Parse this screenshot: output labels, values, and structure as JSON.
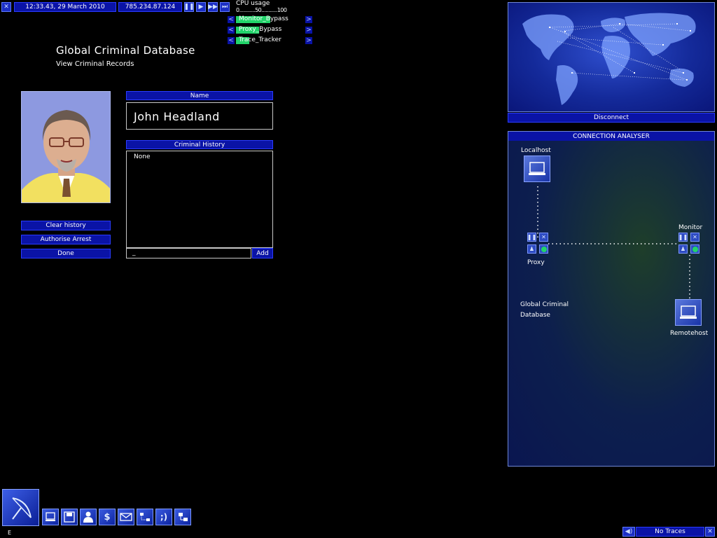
{
  "topbar": {
    "close_icon": "close-icon",
    "datetime": "12:33.43, 29 March 2010",
    "ip": "785.234.87.124",
    "speed_icons": [
      "pause-icon",
      "play-icon",
      "fast-forward-icon",
      "fastest-forward-icon"
    ]
  },
  "cpu": {
    "title": "CPU usage",
    "scale": "0...........50...........100",
    "programs": [
      {
        "name": "Monitor_Bypass",
        "usage": 0.52
      },
      {
        "name": "Proxy_Bypass",
        "usage": 0.35
      },
      {
        "name": "Trace_Tracker",
        "usage": 0.2
      }
    ]
  },
  "page": {
    "title": "Global Criminal Database",
    "subtitle": "View Criminal Records"
  },
  "record": {
    "name_header": "Name",
    "name": "John Headland",
    "history_header": "Criminal History",
    "history_text": "None",
    "new_entry_value": "_",
    "add_label": "Add",
    "buttons": [
      "Clear history",
      "Authorise Arrest",
      "Done"
    ]
  },
  "worldmap": {
    "disconnect_label": "Disconnect"
  },
  "analyser": {
    "title": "CONNECTION ANALYSER",
    "localhost": "Localhost",
    "proxy": "Proxy",
    "monitor": "Monitor",
    "remotehost": "Remotehost",
    "target_line1": "Global Criminal",
    "target_line2": "Database"
  },
  "taskbar": {
    "main_icon": "satellite-dish-icon",
    "tools": [
      "computer-icon",
      "disk-icon",
      "people-icon",
      "dollar-icon",
      "email-icon",
      "network-icon",
      "chat-icon",
      "gateway-icon"
    ],
    "status_letter": "E"
  },
  "trace": {
    "label": "No Traces",
    "sound_icon": "speaker-icon",
    "close_icon": "close-icon"
  },
  "colors": {
    "accent": "#0a13a6",
    "button_border": "#2a3cff",
    "green": "#22d46a"
  }
}
